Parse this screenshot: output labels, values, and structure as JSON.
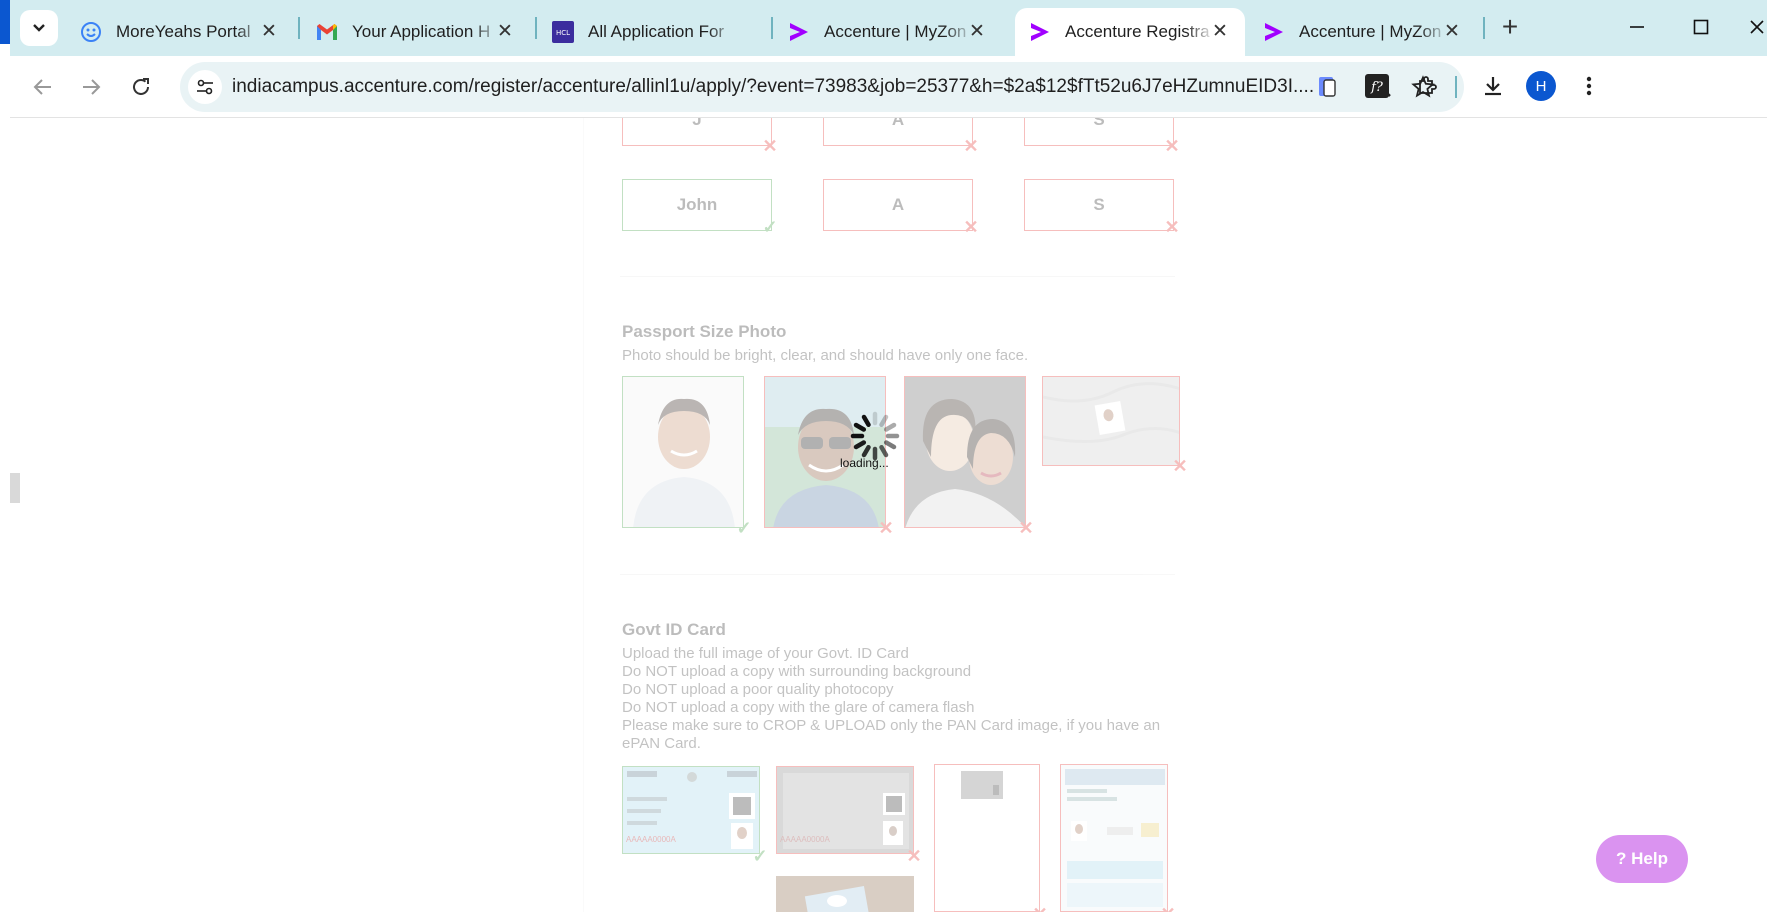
{
  "tabs": [
    {
      "title": "MoreYeahs Portal",
      "favicon": "moreyeahs-icon",
      "active": false
    },
    {
      "title": "Your Application H",
      "favicon": "gmail-icon",
      "active": false
    },
    {
      "title": "All Application For",
      "favicon": "hcl-icon",
      "active": false
    },
    {
      "title": "Accenture | MyZon",
      "favicon": "accenture-icon",
      "active": false
    },
    {
      "title": "Accenture Registra",
      "favicon": "accenture-icon",
      "active": true
    },
    {
      "title": "Accenture | MyZon",
      "favicon": "accenture-icon",
      "active": false
    }
  ],
  "toolbar": {
    "url": "indiacampus.accenture.com/register/accenture/allinl1u/apply/?event=73983&job=25377&h=$2a$12$fTt52u6J7eHZumnuEID3I....",
    "avatar_letter": "H"
  },
  "name_rows": [
    [
      {
        "value": "J",
        "valid": false
      },
      {
        "value": "A",
        "valid": false
      },
      {
        "value": "S",
        "valid": false
      }
    ],
    [
      {
        "value": "John",
        "valid": true
      },
      {
        "value": "A",
        "valid": false
      },
      {
        "value": "S",
        "valid": false
      }
    ]
  ],
  "passport": {
    "title": "Passport Size Photo",
    "hint": "Photo should be bright, clear, and should have only one face.",
    "examples": [
      {
        "name": "single-face-photo",
        "valid": true
      },
      {
        "name": "sunglasses-photo",
        "valid": false
      },
      {
        "name": "two-faces-photo",
        "valid": false
      },
      {
        "name": "small-face-photo",
        "valid": false
      }
    ]
  },
  "govt_id": {
    "title": "Govt ID Card",
    "lines": [
      "Upload the full image of your Govt. ID Card",
      "Do NOT upload a copy with surrounding background",
      "Do NOT upload a poor quality photocopy",
      "Do NOT upload a copy with the glare of camera flash",
      "Please make sure to CROP & UPLOAD only the PAN Card image, if you have an ePAN Card."
    ],
    "card_number": "AAAAA0000A"
  },
  "loading_text": "loading...",
  "help_label": "? Help"
}
